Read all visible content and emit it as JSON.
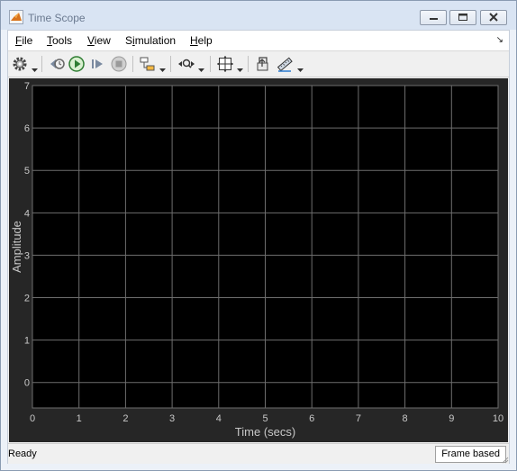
{
  "window": {
    "title": "Time Scope"
  },
  "menu": [
    {
      "label": "File",
      "mnemonic": "F"
    },
    {
      "label": "Tools",
      "mnemonic": "T"
    },
    {
      "label": "View",
      "mnemonic": "V"
    },
    {
      "label": "Simulation",
      "mnemonic": "i"
    },
    {
      "label": "Help",
      "mnemonic": "H"
    }
  ],
  "toolbar": {
    "icons": [
      "settings-icon",
      "step-back-icon",
      "run-icon",
      "step-forward-icon",
      "stop-icon",
      "highlight-block-icon",
      "zoom-icon",
      "autoscale-icon",
      "restore-layout-icon",
      "measurements-icon"
    ]
  },
  "chart_data": {
    "type": "line",
    "series": [],
    "xlabel": "Time (secs)",
    "ylabel": "Amplitude",
    "xlim": [
      0,
      10
    ],
    "ylim": [
      -0.6,
      7
    ],
    "xticks": [
      "0",
      "1",
      "2",
      "3",
      "4",
      "5",
      "6",
      "7",
      "8",
      "9",
      "10"
    ],
    "yticks": [
      "0",
      "1",
      "2",
      "3",
      "4",
      "5",
      "6",
      "7"
    ],
    "grid": true,
    "background": "#000000",
    "grid_color": "#6e6e6e",
    "text_color": "#c8c8c8"
  },
  "status": {
    "left": "Ready",
    "right": "Frame based"
  }
}
